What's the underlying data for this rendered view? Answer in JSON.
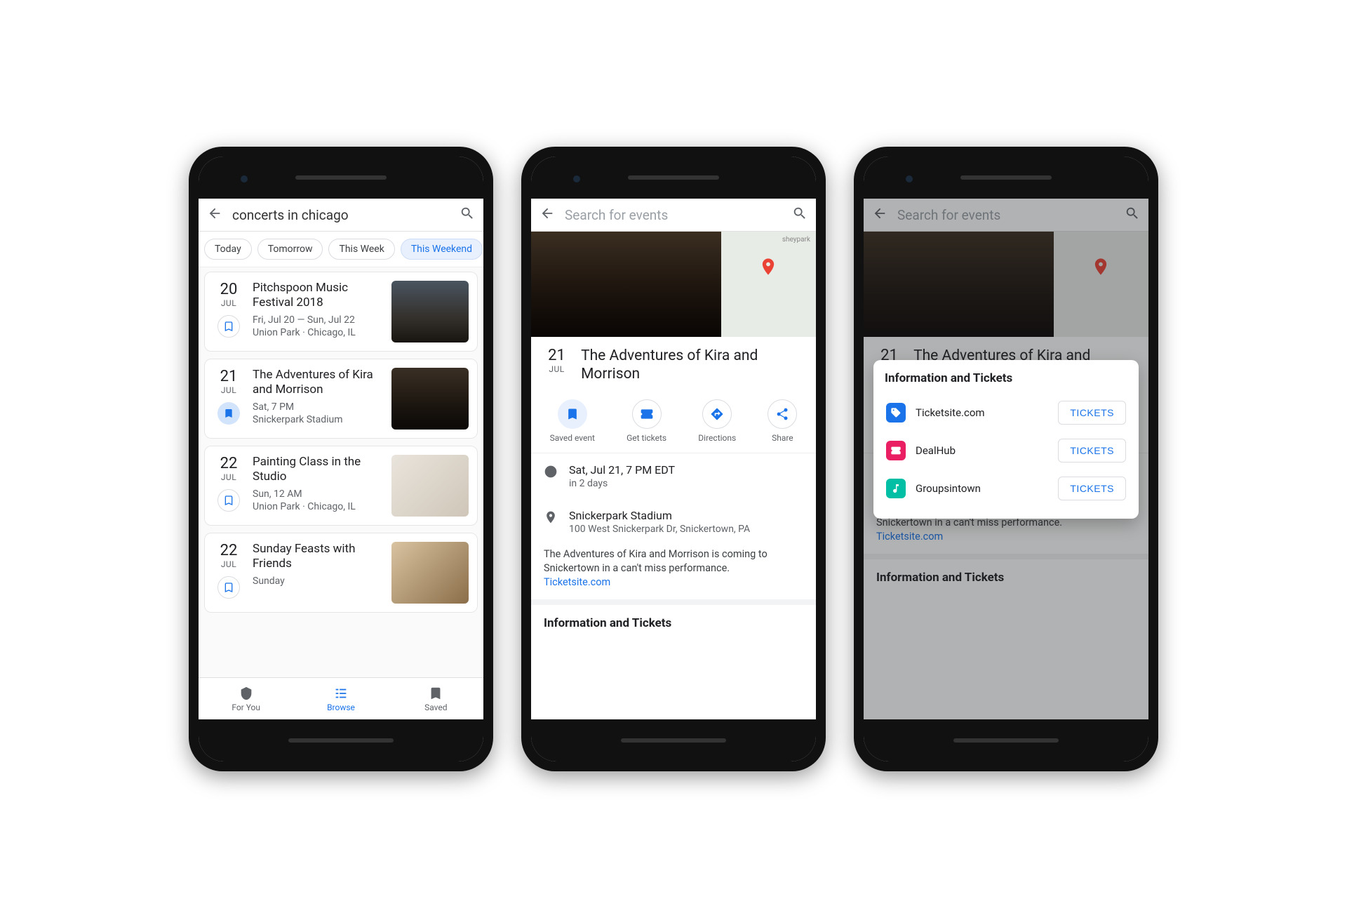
{
  "phone1": {
    "search_query": "concerts in chicago",
    "chips": [
      {
        "label": "Today",
        "active": false
      },
      {
        "label": "Tomorrow",
        "active": false
      },
      {
        "label": "This Week",
        "active": false
      },
      {
        "label": "This Weekend",
        "active": true
      }
    ],
    "events": [
      {
        "day": "20",
        "mon": "JUL",
        "title": "Pitchspoon Music Festival 2018",
        "line1": "Fri, Jul 20 — Sun, Jul 22",
        "line2": "Union Park · Chicago, IL",
        "saved": false,
        "thumb": "crowd"
      },
      {
        "day": "21",
        "mon": "JUL",
        "title": "The Adventures of Kira and Morrison",
        "line1": "Sat, 7 PM",
        "line2": "Snickerpark Stadium",
        "saved": true,
        "thumb": "concert"
      },
      {
        "day": "22",
        "mon": "JUL",
        "title": "Painting Class in the Studio",
        "line1": "Sun, 12 AM",
        "line2": "Union Park · Chicago, IL",
        "saved": false,
        "thumb": "studio"
      },
      {
        "day": "22",
        "mon": "JUL",
        "title": "Sunday Feasts with Friends",
        "line1": "Sunday",
        "line2": "",
        "saved": false,
        "thumb": "food"
      }
    ],
    "nav": {
      "for_you": "For You",
      "browse": "Browse",
      "saved": "Saved"
    }
  },
  "phone2": {
    "search_placeholder": "Search for events",
    "map_label": "sheypark",
    "event": {
      "day": "21",
      "mon": "JUL",
      "title": "The Adventures of Kira and Morrison",
      "actions": {
        "saved": "Saved event",
        "tickets": "Get tickets",
        "directions": "Directions",
        "share": "Share"
      },
      "when_main": "Sat, Jul 21, 7 PM EDT",
      "when_sub": "in 2 days",
      "where_main": "Snickerpark Stadium",
      "where_sub": "100 West Snickerpark Dr, Snickertown, PA",
      "description": "The Adventures of Kira and Morrison is coming to Snickertown in a can't miss performance.",
      "desc_link": "Ticketsite.com",
      "section_head": "Information and Tickets"
    }
  },
  "phone3": {
    "popup_title": "Information and Tickets",
    "providers": [
      {
        "name": "Ticketsite.com",
        "color": "#1a73e8",
        "icon": "tag",
        "button": "TICKETS"
      },
      {
        "name": "DealHub",
        "color": "#e91e63",
        "icon": "ticket",
        "button": "TICKETS"
      },
      {
        "name": "Groupsintown",
        "color": "#00bfa5",
        "icon": "music",
        "button": "TICKETS"
      }
    ]
  }
}
